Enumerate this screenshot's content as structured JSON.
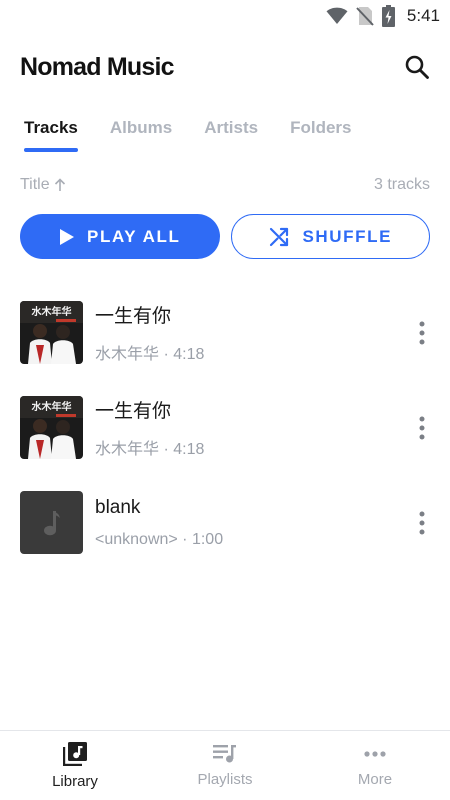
{
  "status_bar": {
    "time": "5:41",
    "icons": [
      "wifi-icon",
      "no-sim-icon",
      "battery-charging-icon"
    ]
  },
  "header": {
    "title": "Nomad Music",
    "search_icon": "search-icon"
  },
  "tabs": [
    {
      "label": "Tracks",
      "active": true
    },
    {
      "label": "Albums",
      "active": false
    },
    {
      "label": "Artists",
      "active": false
    },
    {
      "label": "Folders",
      "active": false
    }
  ],
  "sort": {
    "label": "Title",
    "direction_icon": "arrow-up-icon",
    "count_text": "3 tracks"
  },
  "actions": {
    "play_all_label": "PLAY ALL",
    "shuffle_label": "SHUFFLE"
  },
  "tracks": [
    {
      "title": "一生有你",
      "subtitle": "水木年华 · 4:18",
      "art": "album-cover",
      "art_text": "水木年华"
    },
    {
      "title": "一生有你",
      "subtitle": "水木年华 · 4:18",
      "art": "album-cover",
      "art_text": "水木年华"
    },
    {
      "title": "blank",
      "subtitle": "<unknown> · 1:00",
      "art": "music-note-placeholder"
    }
  ],
  "bottom_nav": [
    {
      "label": "Library",
      "icon": "library-icon",
      "active": true
    },
    {
      "label": "Playlists",
      "icon": "playlist-icon",
      "active": false
    },
    {
      "label": "More",
      "icon": "more-horizontal-icon",
      "active": false
    }
  ],
  "colors": {
    "accent": "#2f6bf5",
    "muted_text": "#a9adb5",
    "inactive_tab": "#b0b5be",
    "blank_art_bg": "#3a3a3a"
  }
}
